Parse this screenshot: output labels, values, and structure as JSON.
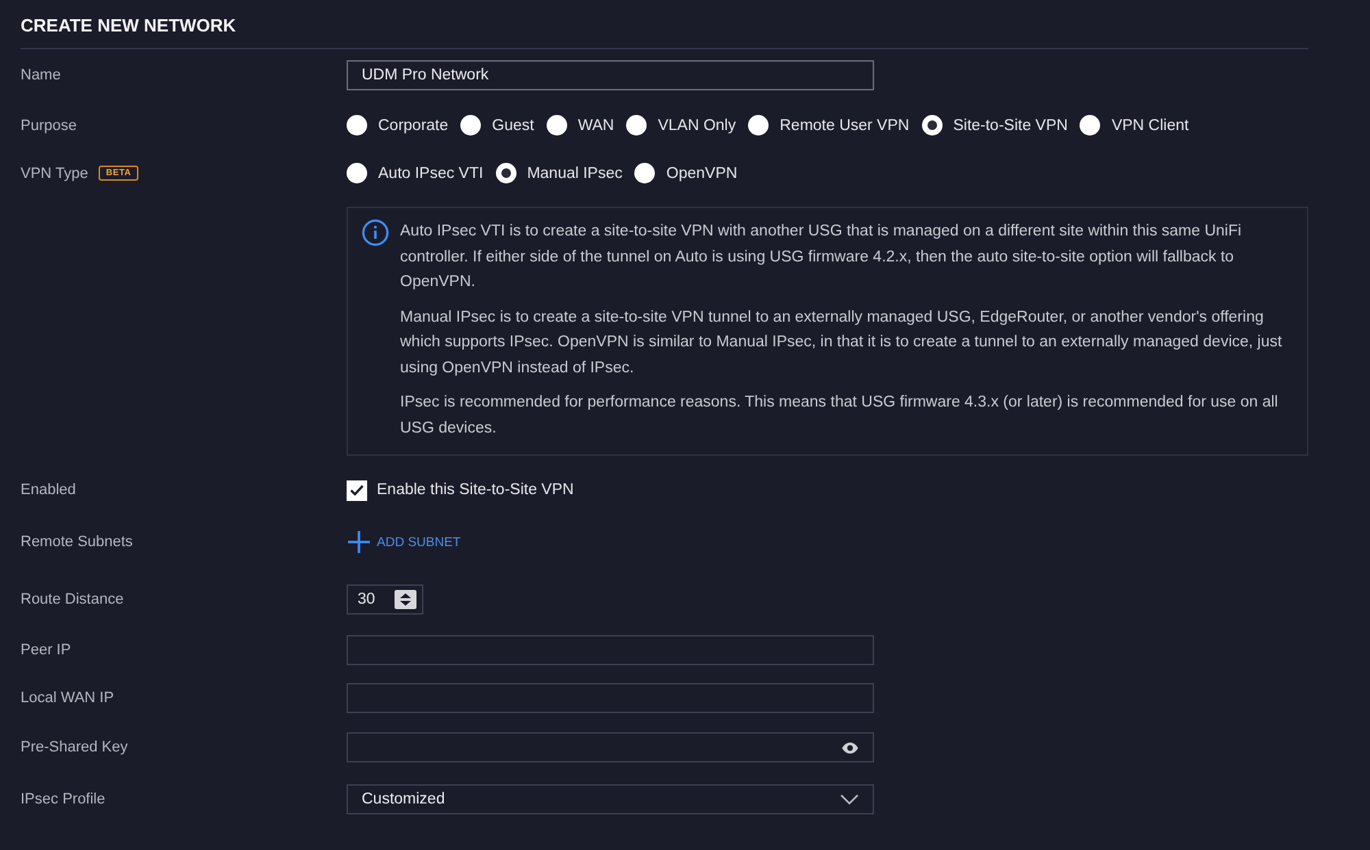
{
  "title": "CREATE NEW NETWORK",
  "fields": [
    {
      "kind": "text",
      "label": "Name",
      "value": "UDM Pro Network"
    },
    {
      "kind": "radio",
      "label": "Purpose",
      "options": [
        {
          "label": "Corporate",
          "selected": false
        },
        {
          "label": "Guest",
          "selected": false
        },
        {
          "label": "WAN",
          "selected": false
        },
        {
          "label": "VLAN Only",
          "selected": false
        },
        {
          "label": "Remote User VPN",
          "selected": false
        },
        {
          "label": "Site-to-Site VPN",
          "selected": true
        },
        {
          "label": "VPN Client",
          "selected": false
        }
      ]
    },
    {
      "kind": "radio",
      "label": "VPN Type",
      "badge": "BETA",
      "options": [
        {
          "label": "Auto IPsec VTI",
          "selected": false
        },
        {
          "label": "Manual IPsec",
          "selected": true
        },
        {
          "label": "OpenVPN",
          "selected": false
        }
      ]
    },
    {
      "kind": "info",
      "paragraphs": [
        "Auto IPsec VTI is to create a site-to-site VPN with another USG that is managed on a different site within this same UniFi controller. If either side of the tunnel on Auto is using USG firmware 4.2.x, then the auto site-to-site option will fallback to OpenVPN.",
        "Manual IPsec is to create a site-to-site VPN tunnel to an externally managed USG, EdgeRouter, or another vendor's offering which supports IPsec. OpenVPN is similar to Manual IPsec, in that it is to create a tunnel to an externally managed device, just using OpenVPN instead of IPsec.",
        "IPsec is recommended for performance reasons. This means that USG firmware 4.3.x (or later) is recommended for use on all USG devices."
      ]
    },
    {
      "kind": "checkbox",
      "label": "Enabled",
      "text": "Enable this Site-to-Site VPN",
      "checked": true
    },
    {
      "kind": "link",
      "label": "Remote Subnets",
      "text": "ADD SUBNET"
    },
    {
      "kind": "number",
      "label": "Route Distance",
      "value": "30"
    },
    {
      "kind": "text",
      "label": "Peer IP"
    },
    {
      "kind": "text",
      "label": "Local WAN IP"
    },
    {
      "kind": "password",
      "label": "Pre-Shared Key"
    },
    {
      "kind": "select",
      "label": "IPsec Profile",
      "value": "Customized"
    }
  ]
}
